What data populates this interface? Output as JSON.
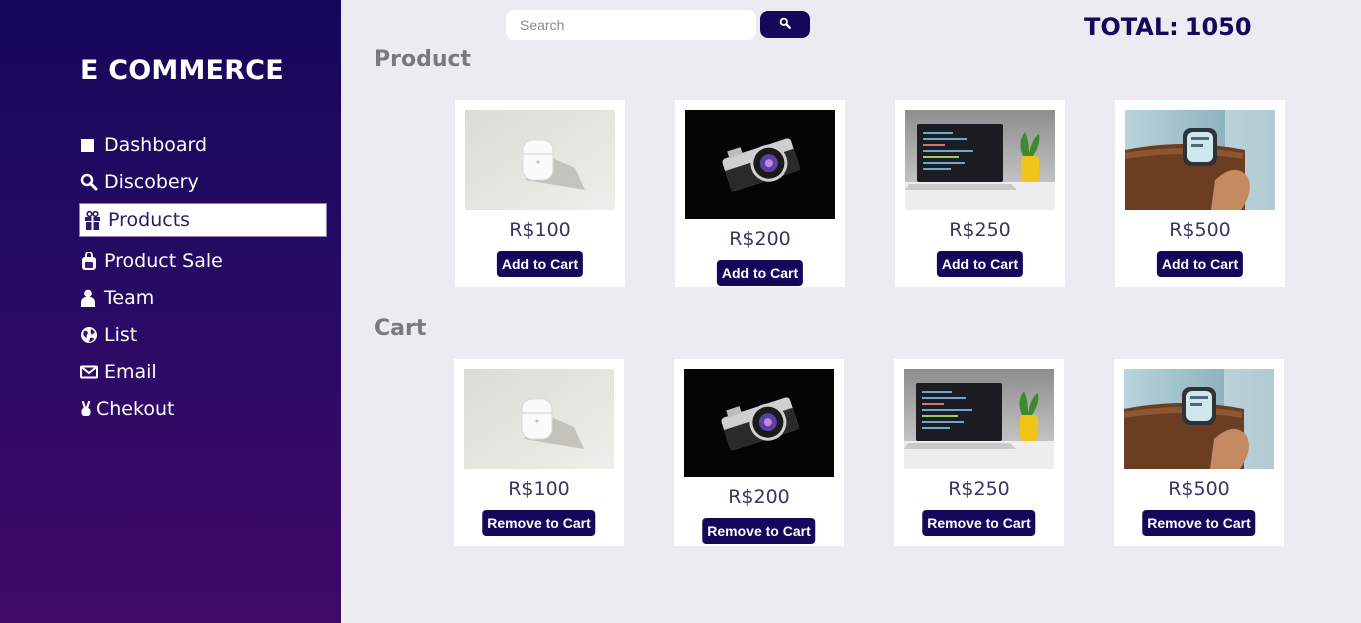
{
  "app": {
    "brand": "E COMMERCE"
  },
  "sidebar": {
    "items": [
      {
        "label": "Dashboard",
        "icon": "square-icon",
        "active": false
      },
      {
        "label": "Discobery",
        "icon": "search-icon",
        "active": false
      },
      {
        "label": "Products",
        "icon": "gift-icon",
        "active": true
      },
      {
        "label": "Product Sale",
        "icon": "bag-icon",
        "active": false
      },
      {
        "label": "Team",
        "icon": "person-icon",
        "active": false
      },
      {
        "label": "List",
        "icon": "globe-icon",
        "active": false
      },
      {
        "label": "Email",
        "icon": "mail-icon",
        "active": false
      },
      {
        "label": "Chekout",
        "icon": "victory-hand-icon",
        "active": false
      }
    ]
  },
  "search": {
    "placeholder": "Search",
    "value": ""
  },
  "header": {
    "total_label": "TOTAL:",
    "total_value": "1050"
  },
  "products": {
    "title": "Product",
    "button_label": "Add to Cart",
    "items": [
      {
        "name": "AirPods",
        "price": "R$100",
        "image": "airpods-image"
      },
      {
        "name": "Camera",
        "price": "R$200",
        "image": "camera-image"
      },
      {
        "name": "Laptop",
        "price": "R$250",
        "image": "laptop-image"
      },
      {
        "name": "Smartwatch",
        "price": "R$500",
        "image": "smartwatch-image"
      }
    ]
  },
  "cart": {
    "title": "Cart",
    "button_label": "Remove to Cart",
    "items": [
      {
        "name": "AirPods",
        "price": "R$100",
        "image": "airpods-image"
      },
      {
        "name": "Camera",
        "price": "R$200",
        "image": "camera-image"
      },
      {
        "name": "Laptop",
        "price": "R$250",
        "image": "laptop-image"
      },
      {
        "name": "Smartwatch",
        "price": "R$500",
        "image": "smartwatch-image"
      }
    ]
  },
  "colors": {
    "brand": "#14085a",
    "background": "#edebf2",
    "sidebar_top": "#14085a",
    "sidebar_bottom": "#3f0a66"
  }
}
